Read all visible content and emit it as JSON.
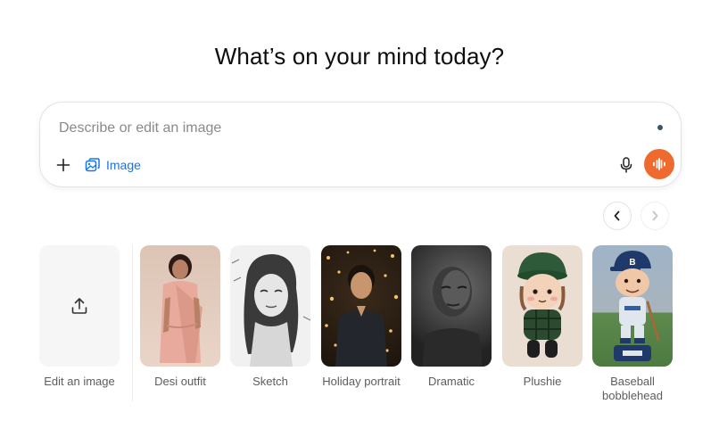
{
  "heading": "What’s on your mind today?",
  "composer": {
    "placeholder": "Describe or edit an image",
    "image_label": "Image"
  },
  "icons": {
    "plus": "plus-icon",
    "image": "image-icon",
    "mic": "microphone-icon",
    "voice": "voice-waveform-icon",
    "prev": "chevron-left-icon",
    "next": "chevron-right-icon",
    "upload": "upload-icon"
  },
  "colors": {
    "accent_link": "#1a73e8",
    "voice_button": "#ef6a2e"
  },
  "styles": {
    "items": [
      {
        "label": "Edit an image"
      },
      {
        "label": "Desi outfit"
      },
      {
        "label": "Sketch"
      },
      {
        "label": "Holiday portrait"
      },
      {
        "label": "Dramatic"
      },
      {
        "label": "Plushie"
      },
      {
        "label": "Baseball bobblehead"
      }
    ]
  }
}
